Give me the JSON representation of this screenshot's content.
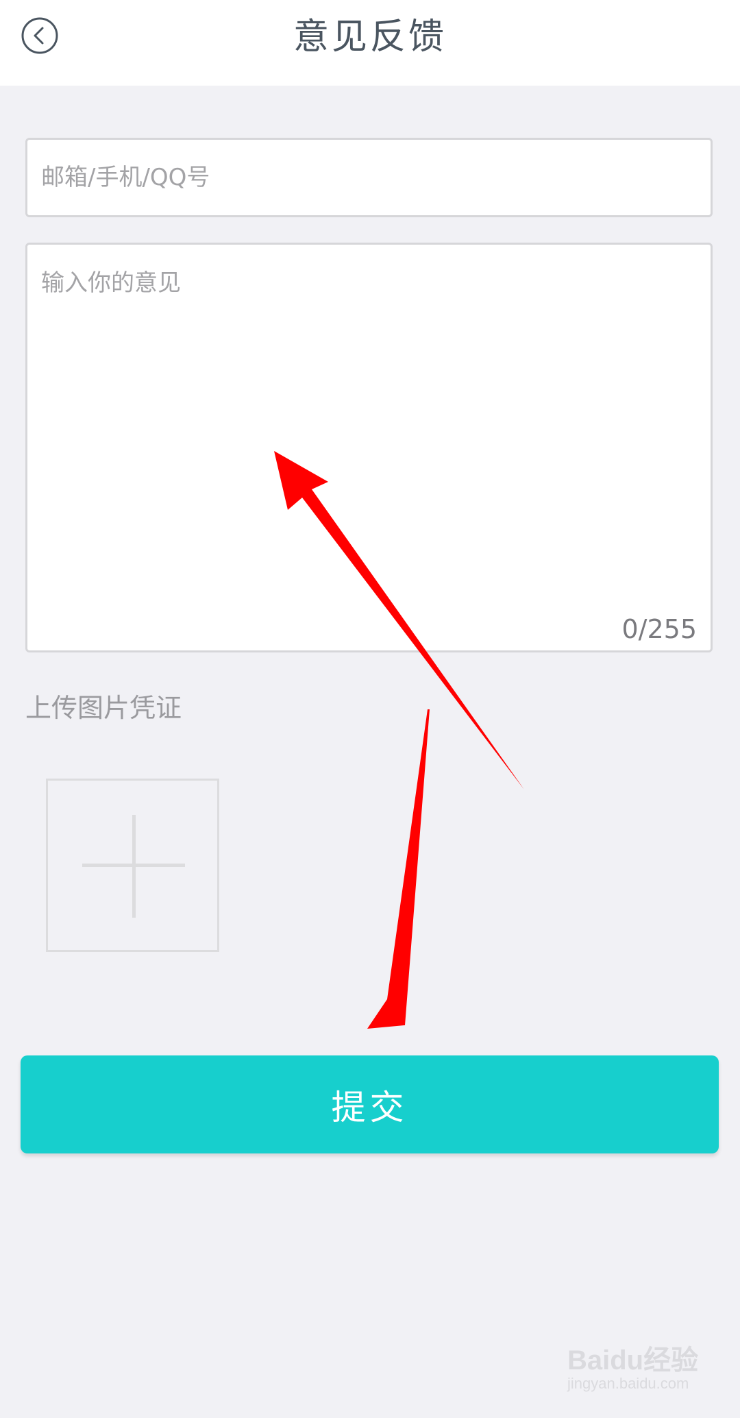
{
  "header": {
    "title": "意见反馈",
    "back_icon": "chevron-left-icon"
  },
  "form": {
    "contact_placeholder": "邮箱/手机/QQ号",
    "contact_value": "",
    "feedback_placeholder": "输入你的意见",
    "feedback_value": "",
    "char_counter": "0/255",
    "upload_label": "上传图片凭证",
    "upload_icon": "plus-icon",
    "submit_label": "提交"
  },
  "watermark": {
    "brand": "Baidu经验",
    "url": "jingyan.baidu.com"
  },
  "colors": {
    "accent": "#17cfcd",
    "background": "#f1f1f5",
    "annotation_arrow": "#ff0000"
  }
}
